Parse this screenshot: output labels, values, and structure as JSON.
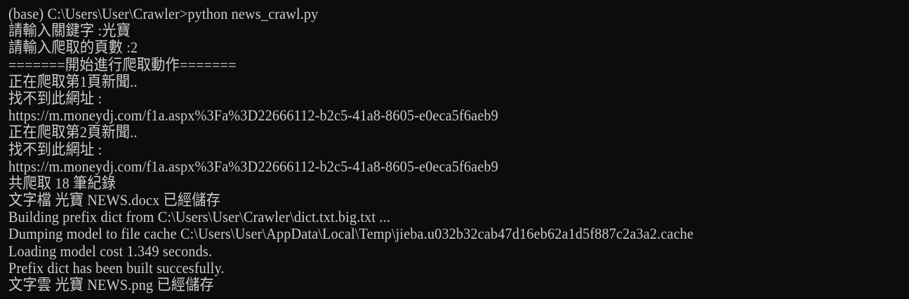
{
  "console": {
    "lines": [
      "(base) C:\\Users\\User\\Crawler>python news_crawl.py",
      "請輸入關鍵字 :光寶",
      "請輸入爬取的頁數 :2",
      "=======開始進行爬取動作=======",
      "正在爬取第1頁新聞..",
      "找不到此網址 :",
      "https://m.moneydj.com/f1a.aspx%3Fa%3D22666112-b2c5-41a8-8605-e0eca5f6aeb9",
      "正在爬取第2頁新聞..",
      "找不到此網址 :",
      "https://m.moneydj.com/f1a.aspx%3Fa%3D22666112-b2c5-41a8-8605-e0eca5f6aeb9",
      "共爬取 18 筆紀錄",
      "文字檔 光寶 NEWS.docx 已經儲存",
      "Building prefix dict from C:\\Users\\User\\Crawler\\dict.txt.big.txt ...",
      "Dumping model to file cache C:\\Users\\User\\AppData\\Local\\Temp\\jieba.u032b32cab47d16eb62a1d5f887c2a3a2.cache",
      "Loading model cost 1.349 seconds.",
      "Prefix dict has been built succesfully.",
      "文字雲 光寶 NEWS.png 已經儲存"
    ]
  },
  "colors": {
    "background": "#0c0c0c",
    "text": "#cccccc"
  }
}
